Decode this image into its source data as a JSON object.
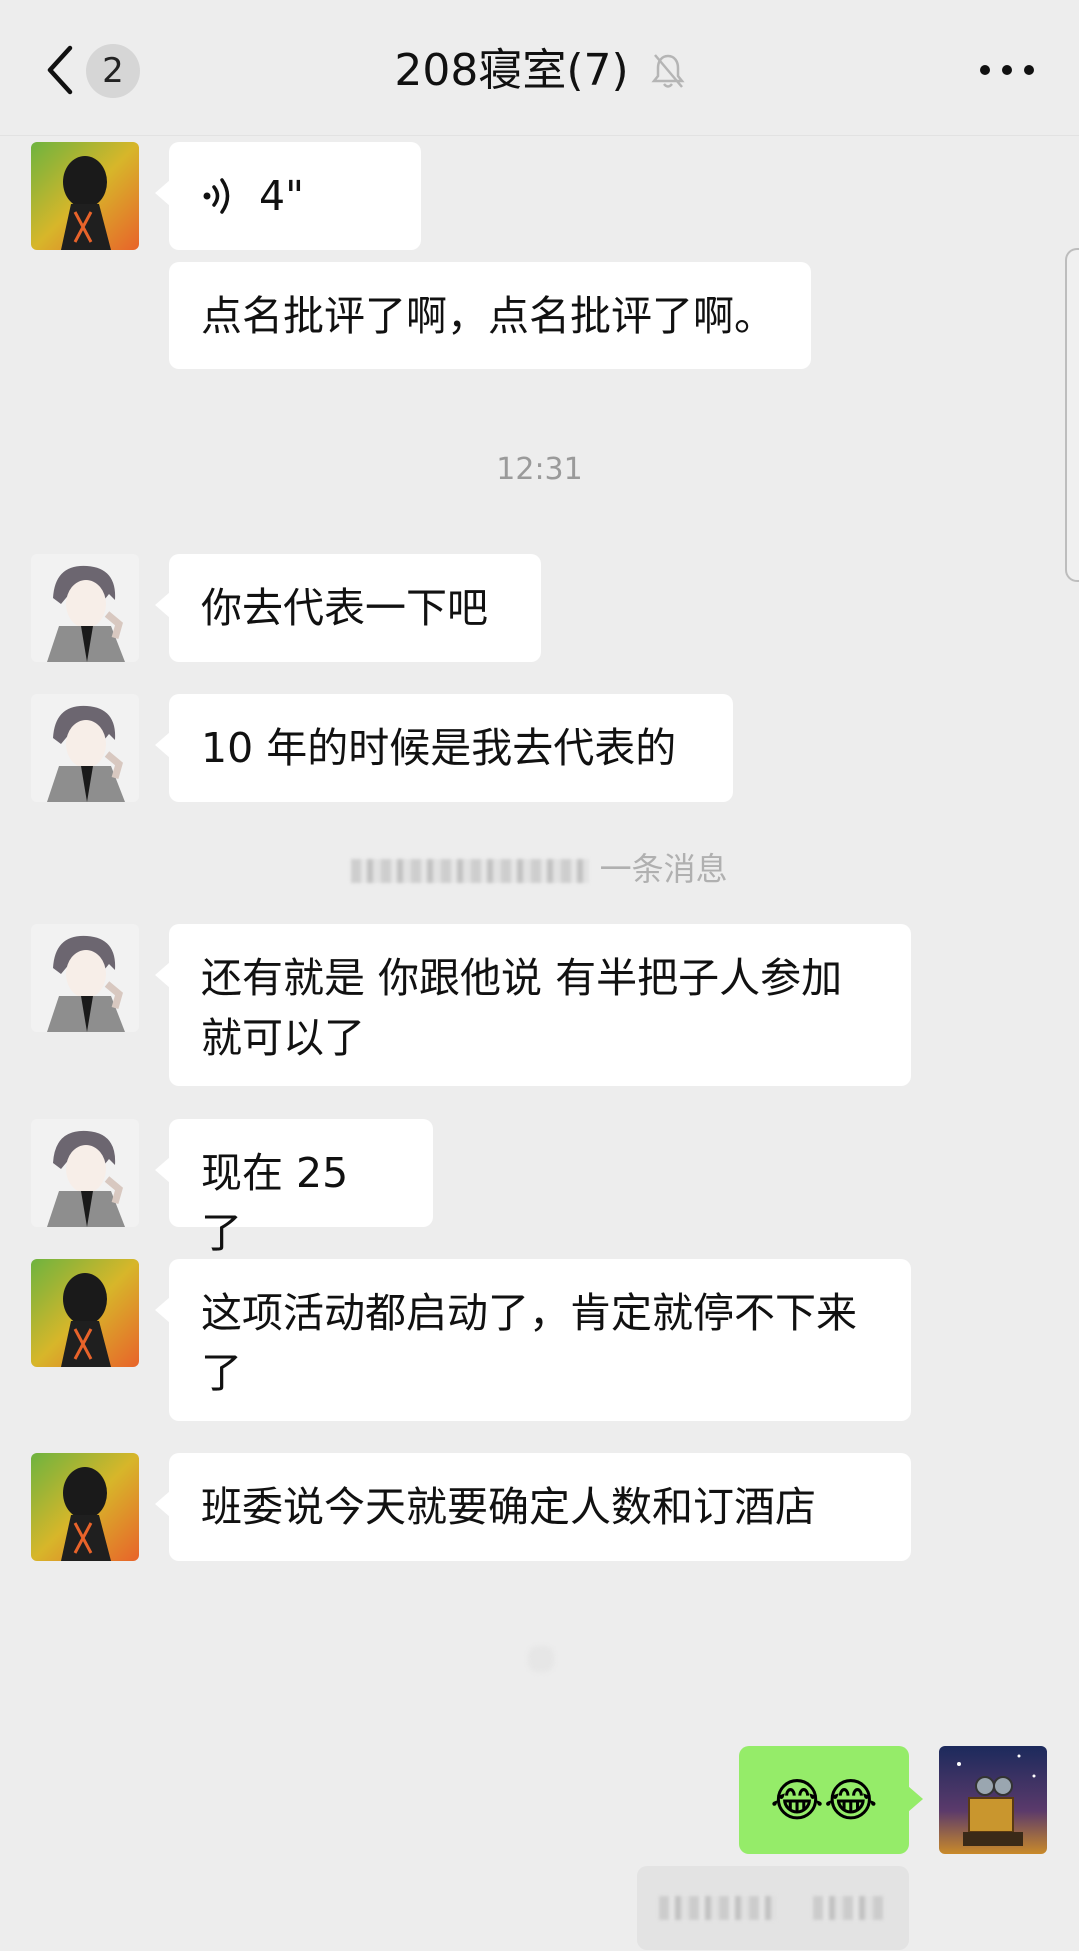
{
  "header": {
    "unread_count": "2",
    "title": "208寝室(7)",
    "back_icon": "chevron-left-icon",
    "mute_icon": "bell-off-icon",
    "more_icon": "more-icon"
  },
  "messages": [
    {
      "sender": "green-avatar",
      "type": "voice",
      "duration": "4\""
    },
    {
      "sender": "green-avatar",
      "type": "text",
      "text": "点名批评了啊，点名批评了啊。"
    },
    {
      "type": "timestamp",
      "text": "12:31"
    },
    {
      "sender": "gray-avatar",
      "type": "text",
      "text": "你去代表一下吧"
    },
    {
      "sender": "gray-avatar",
      "type": "text",
      "text": "10 年的时候是我去代表的"
    },
    {
      "type": "system",
      "text": "一条消息"
    },
    {
      "sender": "gray-avatar",
      "type": "text",
      "text": "还有就是 你跟他说 有半把子人参加就可以了"
    },
    {
      "sender": "gray-avatar",
      "type": "text",
      "text": "现在 25 了"
    },
    {
      "sender": "green-avatar",
      "type": "text",
      "text": "这项活动都启动了，肯定就停不下来了"
    },
    {
      "sender": "green-avatar",
      "type": "text",
      "text": "班委说今天就要确定人数和订酒店"
    },
    {
      "sender": "self",
      "type": "emoji",
      "text": "😂😂"
    }
  ],
  "colors": {
    "background": "#ededed",
    "bubble_other": "#ffffff",
    "bubble_self": "#95ec69"
  }
}
